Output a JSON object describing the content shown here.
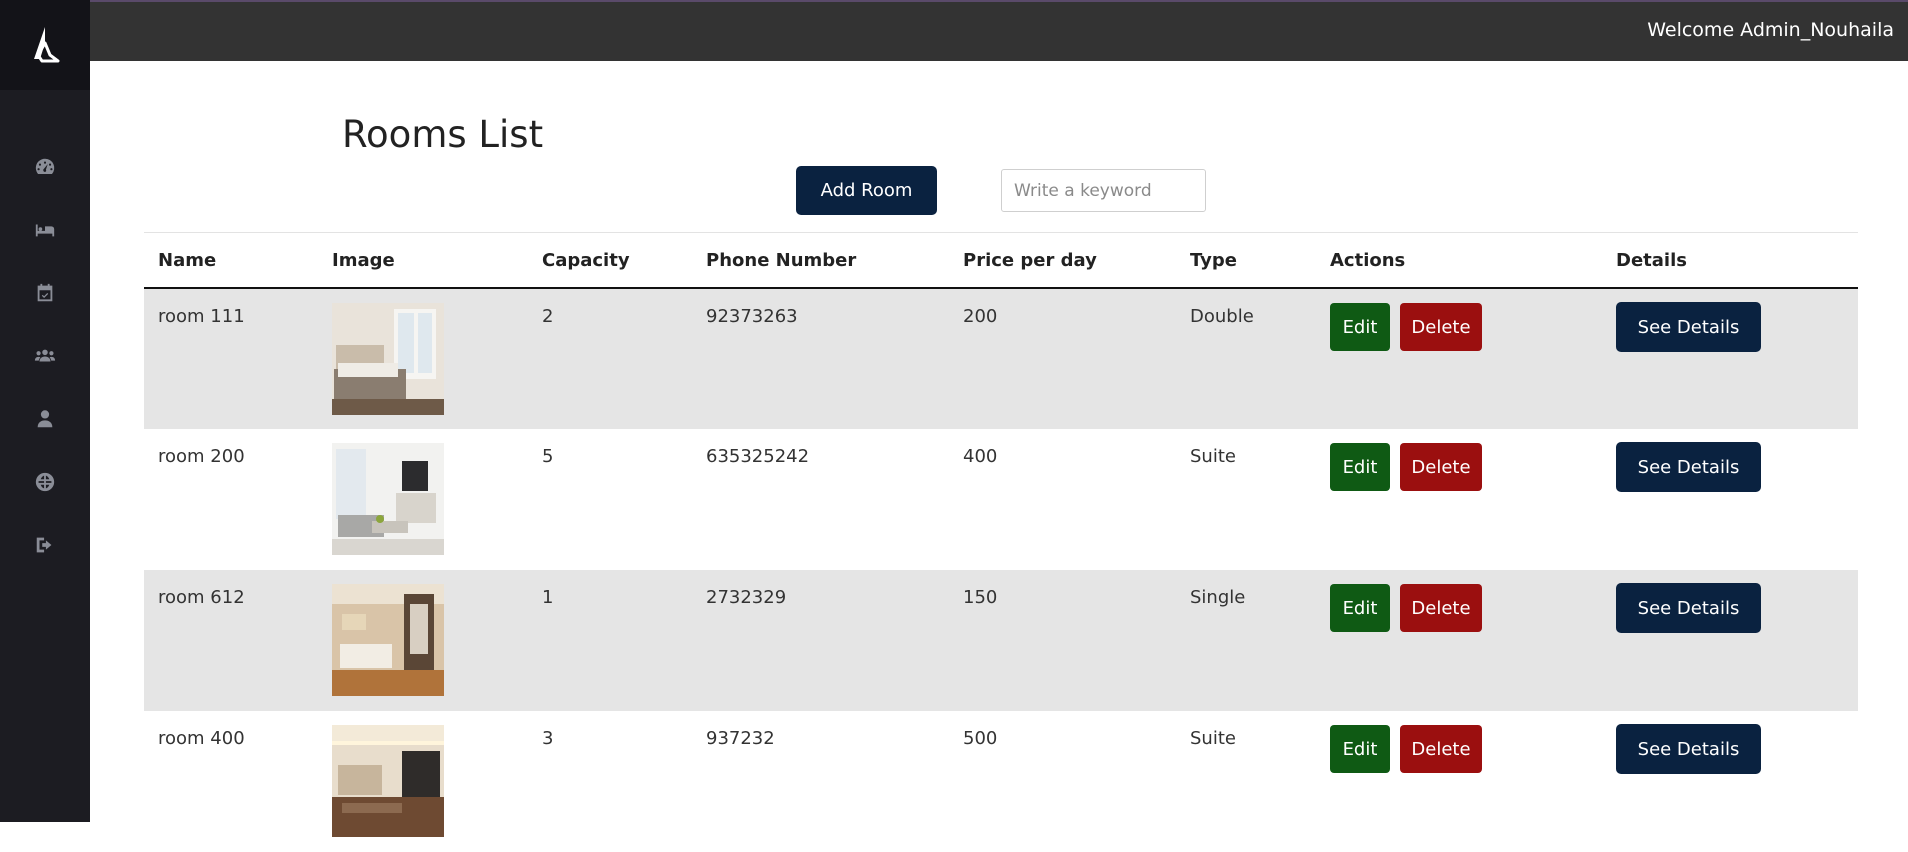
{
  "topbar": {
    "welcome": "Welcome Admin_Nouhaila"
  },
  "sidebar": {
    "logo": "logo-icon",
    "items": [
      {
        "icon": "dashboard-icon"
      },
      {
        "icon": "bed-icon"
      },
      {
        "icon": "calendar-icon"
      },
      {
        "icon": "users-icon"
      },
      {
        "icon": "user-icon"
      },
      {
        "icon": "globe-icon"
      },
      {
        "icon": "logout-icon"
      }
    ]
  },
  "page": {
    "title": "Rooms List",
    "add_button": "Add Room",
    "search_placeholder": "Write a keyword"
  },
  "table": {
    "headers": [
      "Name",
      "Image",
      "Capacity",
      "Phone Number",
      "Price per day",
      "Type",
      "Actions",
      "Details"
    ],
    "rows": [
      {
        "name": "room 111",
        "capacity": "2",
        "phone": "92373263",
        "price": "200",
        "type": "Double"
      },
      {
        "name": "room 200",
        "capacity": "5",
        "phone": "635325242",
        "price": "400",
        "type": "Suite"
      },
      {
        "name": "room 612",
        "capacity": "1",
        "phone": "2732329",
        "price": "150",
        "type": "Single"
      },
      {
        "name": "room 400",
        "capacity": "3",
        "phone": "937232",
        "price": "500",
        "type": "Suite"
      }
    ],
    "edit_label": "Edit",
    "delete_label": "Delete",
    "details_label": "See Details"
  },
  "colors": {
    "sidebar": "#1c1c22",
    "topbar": "#333333",
    "primary": "#0a2240",
    "edit": "#0f5a14",
    "delete": "#9b0f0f",
    "row_stripe": "#e5e5e5"
  }
}
